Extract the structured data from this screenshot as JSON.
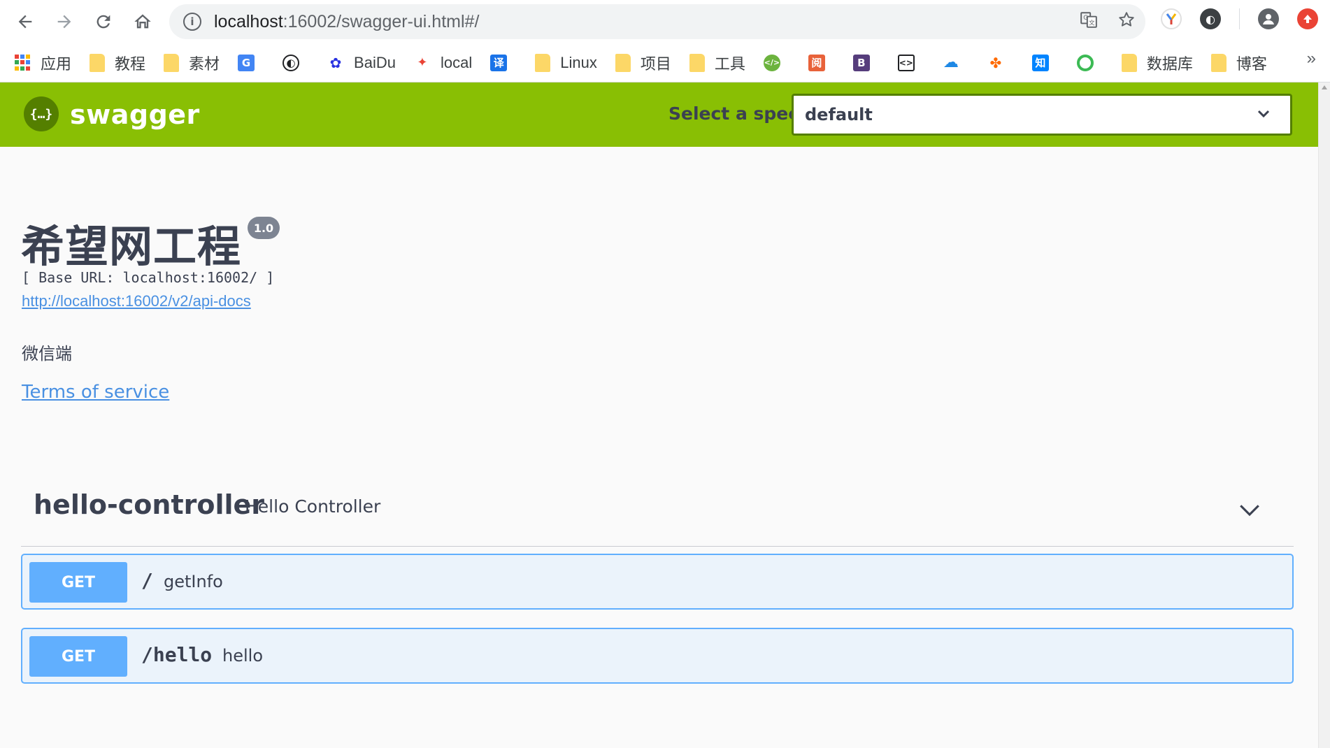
{
  "browser": {
    "url_host": "localhost",
    "url_rest": ":16002/swagger-ui.html#/"
  },
  "bookmarks": [
    {
      "label": "应用",
      "icon": "apps-grid-icon"
    },
    {
      "label": "教程",
      "icon": "folder-icon"
    },
    {
      "label": "素材",
      "icon": "folder-icon"
    },
    {
      "label": "",
      "icon": "google-translate-icon"
    },
    {
      "label": "",
      "icon": "circle-logo-icon"
    },
    {
      "label": "BaiDu",
      "icon": "baidu-paw-icon"
    },
    {
      "label": "local",
      "icon": "pinwheel-icon"
    },
    {
      "label": "",
      "icon": "translate-icon"
    },
    {
      "label": "Linux",
      "icon": "folder-icon"
    },
    {
      "label": "项目",
      "icon": "folder-icon"
    },
    {
      "label": "工具",
      "icon": "folder-icon"
    },
    {
      "label": "",
      "icon": "code-icon"
    },
    {
      "label": "",
      "icon": "youdao-icon"
    },
    {
      "label": "",
      "icon": "bootstrap-icon"
    },
    {
      "label": "",
      "icon": "link-icon"
    },
    {
      "label": "",
      "icon": "cloud-icon"
    },
    {
      "label": "",
      "icon": "alibaba-icon"
    },
    {
      "label": "",
      "icon": "zhihu-icon"
    },
    {
      "label": "",
      "icon": "ring-icon"
    },
    {
      "label": "数据库",
      "icon": "folder-icon"
    },
    {
      "label": "博客",
      "icon": "folder-icon"
    }
  ],
  "swagger": {
    "logo_text": "swagger",
    "select_label": "Select a spec",
    "select_value": "default"
  },
  "info": {
    "title": "希望网工程",
    "version": "1.0",
    "base_url": "[ Base URL: localhost:16002/ ]",
    "api_docs_link": "http://localhost:16002/v2/api-docs",
    "description": "微信端",
    "terms": "Terms of service"
  },
  "tag": {
    "name": "hello-controller",
    "description": "Hello Controller"
  },
  "operations": [
    {
      "method": "GET",
      "path": "/",
      "summary": "getInfo"
    },
    {
      "method": "GET",
      "path": "/hello",
      "summary": "hello"
    }
  ],
  "colors": {
    "swagger_green": "#89bf04",
    "get_blue": "#61affe",
    "get_bg": "#ebf3fb",
    "link": "#4990e2"
  }
}
